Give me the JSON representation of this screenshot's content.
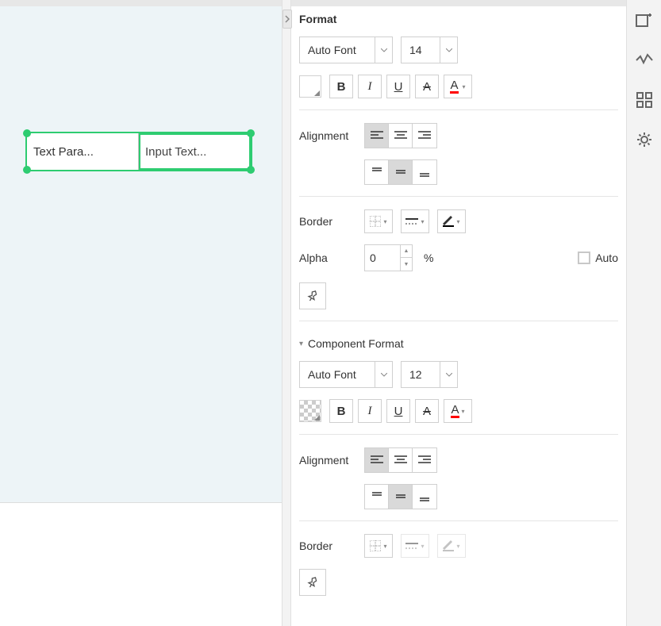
{
  "canvas": {
    "label": "Text Para...",
    "placeholder": "Input Text..."
  },
  "panel": {
    "title": "Format",
    "format": {
      "font": "Auto Font",
      "size": "14",
      "alignment_label": "Alignment",
      "border_label": "Border",
      "alpha_label": "Alpha",
      "alpha_value": "0",
      "percent": "%",
      "auto_label": "Auto"
    },
    "component": {
      "title": "Component Format",
      "font": "Auto Font",
      "size": "12",
      "alignment_label": "Alignment",
      "border_label": "Border"
    }
  }
}
